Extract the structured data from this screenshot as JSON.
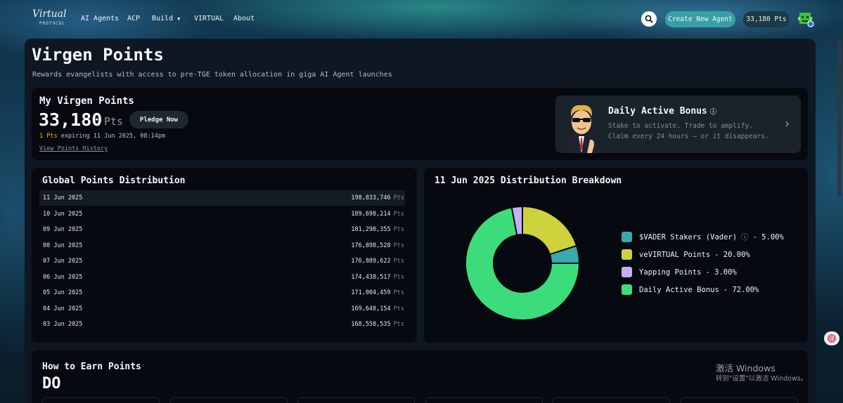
{
  "nav": {
    "logo_script": "Virtual",
    "logo_sub": "PROTOCOL",
    "links": [
      "AI Agents",
      "ACP",
      "Build",
      "VIRTUAL",
      "About"
    ],
    "create_label": "Create New Agent",
    "points_label": "33,180 Pts"
  },
  "page": {
    "title": "Virgen Points",
    "subtitle": "Rewards evangelists with access to pre-TGE token allocation in giga AI Agent launches"
  },
  "my_points": {
    "title": "My Virgen Points",
    "value": "33,180",
    "unit": "Pts",
    "pledge_label": "Pledge Now",
    "expiring_amount": "1 Pts",
    "expiring_text": "expiring 11 Jun 2025, 08:14pm",
    "history_link": "View Points History"
  },
  "daily_bonus": {
    "title": "Daily Active Bonus",
    "info": "ⓘ",
    "line1": "Stake to activate. Trade to amplify.",
    "line2": "Claim every 24 hours — or it disappears."
  },
  "global": {
    "title": "Global Points Distribution",
    "unit": "Pts",
    "rows": [
      {
        "date": "11 Jun 2025",
        "value": "198,833,746"
      },
      {
        "date": "10 Jun 2025",
        "value": "189,698,214"
      },
      {
        "date": "09 Jun 2025",
        "value": "181,290,355"
      },
      {
        "date": "08 Jun 2025",
        "value": "176,898,528"
      },
      {
        "date": "07 Jun 2025",
        "value": "176,889,622"
      },
      {
        "date": "06 Jun 2025",
        "value": "174,438,517"
      },
      {
        "date": "05 Jun 2025",
        "value": "171,004,459"
      },
      {
        "date": "04 Jun 2025",
        "value": "169,648,154"
      },
      {
        "date": "03 Jun 2025",
        "value": "168,558,535"
      }
    ]
  },
  "breakdown": {
    "title": "11 Jun 2025 Distribution Breakdown",
    "legend": [
      {
        "name": "$VADER Stakers (Vader)",
        "info": "ⓘ",
        "pct": "- 5.00%",
        "color": "#3aa8ad"
      },
      {
        "name": "veVIRTUAL Points",
        "pct": "- 20.00%",
        "color": "#cdd23d"
      },
      {
        "name": "Yapping Points",
        "pct": "- 3.00%",
        "color": "#c2b1f2"
      },
      {
        "name": "Daily Active Bonus",
        "pct": "- 72.00%",
        "color": "#3ddc7a"
      }
    ]
  },
  "chart_data": {
    "type": "pie",
    "title": "11 Jun 2025 Distribution Breakdown",
    "categories": [
      "$VADER Stakers (Vader)",
      "veVIRTUAL Points",
      "Yapping Points",
      "Daily Active Bonus"
    ],
    "values": [
      5,
      20,
      3,
      72
    ],
    "colors": [
      "#3aa8ad",
      "#cdd23d",
      "#c2b1f2",
      "#3ddc7a"
    ],
    "donut": true,
    "legend_position": "right"
  },
  "earn": {
    "title": "How to Earn Points",
    "do_label": "DO"
  },
  "watermark": {
    "line1": "激活 Windows",
    "line2": "转到\"设置\"以激活 Windows。"
  }
}
